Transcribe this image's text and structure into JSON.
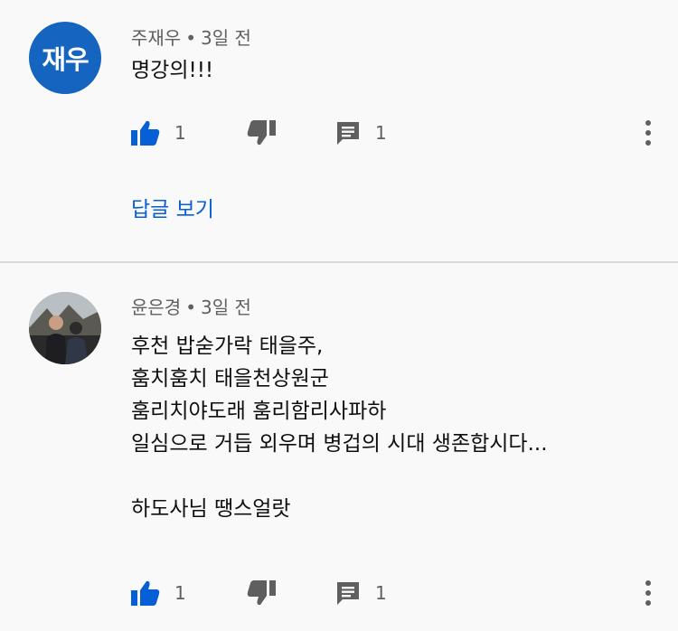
{
  "comments": [
    {
      "avatar_text": "재우",
      "author": "주재우",
      "time": "3일 전",
      "lines": [
        "명강의!!!"
      ],
      "likes": "1",
      "replies": "1",
      "view_replies_label": "답글 보기"
    },
    {
      "author": "윤은경",
      "time": "3일 전",
      "lines": [
        "후천 밥숟가락 태을주,",
        "훔치훔치 태을천상원군",
        "훔리치야도래 훔리함리사파하",
        "일심으로 거듭 외우며 병겁의 시대 생존합시다...",
        "",
        "하도사님 땡스얼랏"
      ],
      "likes": "1",
      "replies": "1"
    }
  ],
  "separator": "•",
  "colors": {
    "accent": "#065fd4",
    "avatar_bg": "#1565c0",
    "muted": "#606060"
  },
  "icons": [
    "thumbs-up-icon",
    "thumbs-down-icon",
    "reply-comment-icon",
    "more-vert-icon"
  ]
}
